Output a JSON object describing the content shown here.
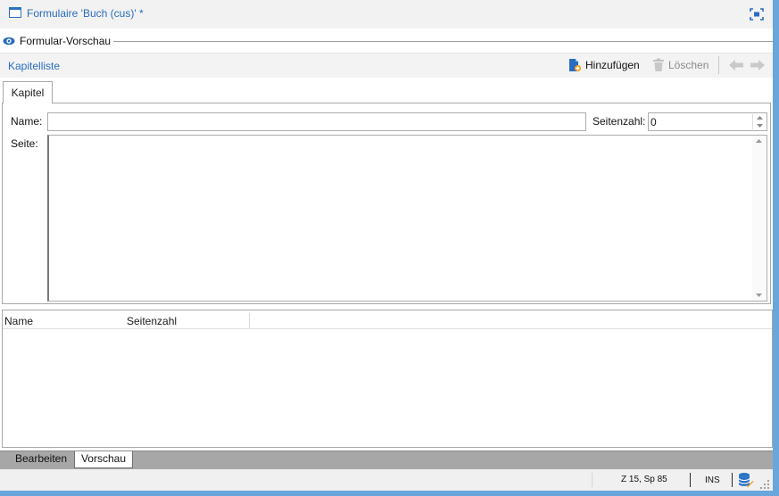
{
  "titlebar": {
    "title": "Formulaire 'Buch (cus)' *",
    "icons": [
      "window-icon",
      "maximize-icon"
    ]
  },
  "preview_section": {
    "label": "Formular-Vorschau",
    "icon": "eye-icon"
  },
  "toolbar": {
    "link": "Kapitelliste",
    "add_label": "Hinzufügen",
    "delete_label": "Löschen",
    "icons": [
      "add-page-icon",
      "trash-icon",
      "arrow-left-icon",
      "arrow-right-icon"
    ]
  },
  "tab": {
    "label": "Kapitel"
  },
  "form": {
    "name_label": "Name:",
    "name_value": "",
    "pagecount_label": "Seitenzahl:",
    "pagecount_value": "0",
    "page_label": "Seite:",
    "page_value": ""
  },
  "table": {
    "columns": [
      "Name",
      "Seitenzahl"
    ],
    "rows": []
  },
  "bottom_tabs": [
    {
      "label": "Bearbeiten",
      "active": false
    },
    {
      "label": "Vorschau",
      "active": true
    }
  ],
  "statusbar": {
    "position": "Z 15, Sp 85",
    "mode": "INS",
    "icons": [
      "database-icon",
      "resize-grip-icon"
    ]
  },
  "colors": {
    "accent": "#2a6cc0",
    "frame": "#6aa6dc",
    "tabstrip": "#a7a7a7",
    "statusbar": "#f0f0f0"
  }
}
